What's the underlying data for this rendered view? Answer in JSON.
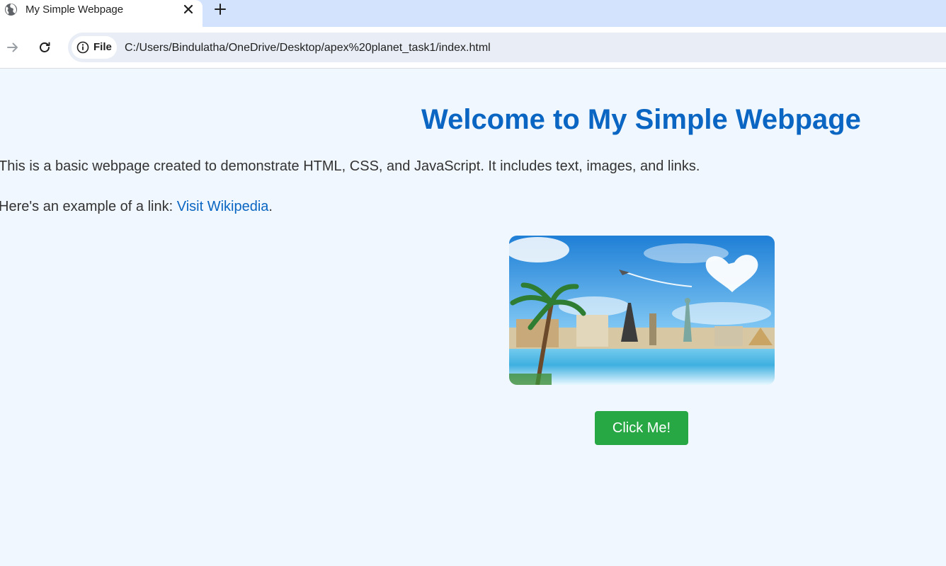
{
  "browser": {
    "tab": {
      "title": "My Simple Webpage",
      "favicon": "globe-icon",
      "close_icon": "close-icon"
    },
    "new_tab_icon": "plus-icon",
    "toolbar": {
      "forward_icon": "arrow-right-icon",
      "reload_icon": "reload-icon",
      "site_info_icon": "info-icon",
      "site_chip_label": "File",
      "url": "C:/Users/Bindulatha/OneDrive/Desktop/apex%20planet_task1/index.html"
    }
  },
  "page": {
    "title": "Welcome to My Simple Webpage",
    "intro": "This is a basic webpage created to demonstrate HTML, CSS, and JavaScript. It includes text, images, and links.",
    "link_prefix": "Here's an example of a link: ",
    "link_text": "Visit Wikipedia",
    "link_suffix": ".",
    "image": "travel-landmarks-image",
    "button_label": "Click Me!"
  },
  "colors": {
    "page_background": "#f0f7fe",
    "heading": "#0a66c2",
    "link": "#0a66c2",
    "body_text": "#333333",
    "button_background": "#28a745",
    "button_text": "#ffffff",
    "tabstrip": "#d3e3fd",
    "omnibox": "#e9eef6"
  }
}
